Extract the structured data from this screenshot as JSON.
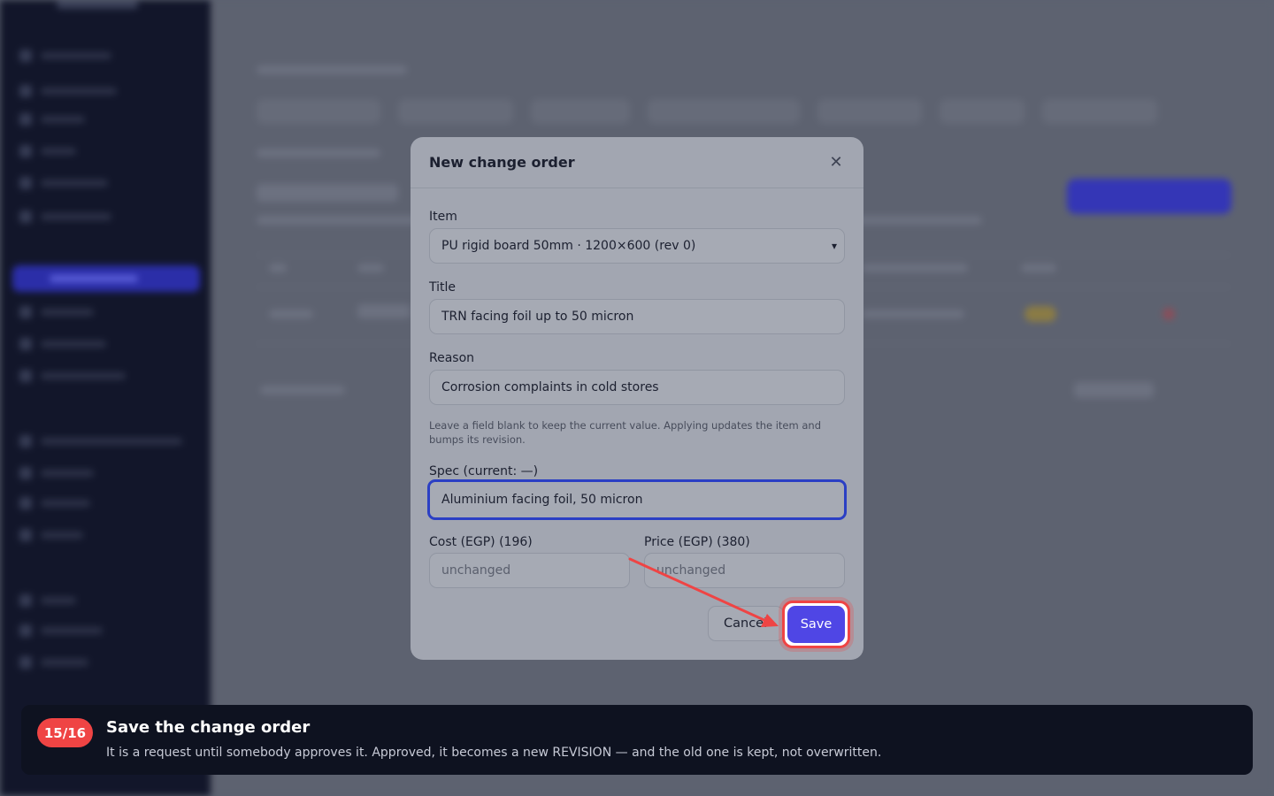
{
  "modal": {
    "title": "New change order",
    "close_icon": "close-icon",
    "item_label": "Item",
    "item_value": "PU rigid board 50mm · 1200×600 (rev 0)",
    "title_label": "Title",
    "title_value": "TRN facing foil up to 50 micron",
    "reason_label": "Reason",
    "reason_value": "Corrosion complaints in cold stores",
    "hint": "Leave a field blank to keep the current value. Applying updates the item and bumps its revision.",
    "spec_label": "Spec (current: —)",
    "spec_value": "Aluminium facing foil, 50 micron",
    "cost_label": "Cost (EGP) (196)",
    "cost_placeholder": "unchanged",
    "price_label": "Price (EGP) (380)",
    "price_placeholder": "unchanged",
    "cancel_label": "Cancel",
    "save_label": "Save"
  },
  "tour": {
    "step": "15/16",
    "title": "Save the change order",
    "text": "It is a request until somebody approves it. Approved, it becomes a new REVISION — and the old one is kept, not overwritten."
  },
  "colors": {
    "accent": "#4f46e5",
    "highlight": "#ef4444",
    "banner": "#0e1220"
  }
}
